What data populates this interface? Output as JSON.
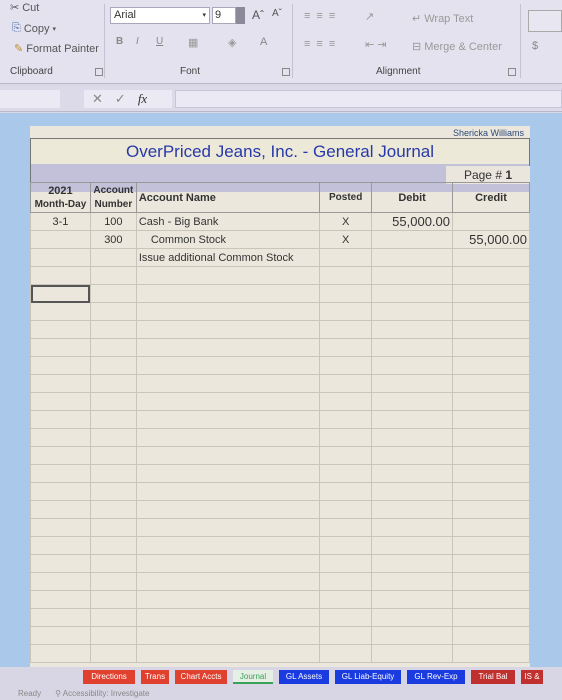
{
  "ribbon": {
    "clipboard": {
      "cut": "Cut",
      "copy": "Copy",
      "format_painter": "Format Painter",
      "label": "Clipboard"
    },
    "font": {
      "font_name": "Arial",
      "font_size": "9",
      "bold": "B",
      "italic": "I",
      "underline": "U",
      "grow": "Aˆ",
      "shrink": "Aˇ",
      "font_color": "A",
      "label": "Font"
    },
    "alignment": {
      "wrap_text": "Wrap Text",
      "merge_center": "Merge & Center",
      "label": "Alignment"
    },
    "number": {
      "currency": "$"
    }
  },
  "formula_bar": {
    "cancel": "✕",
    "enter": "✓",
    "fx": "fx",
    "value": ""
  },
  "journal": {
    "author": "Shericka Williams",
    "title": "OverPriced Jeans, Inc.  -  General Journal",
    "page_label": "Page #",
    "page_number": "1",
    "headers": {
      "year": "2021",
      "month_day": "Month-Day",
      "account": "Account",
      "number": "Number",
      "account_name": "Account Name",
      "posted": "Posted",
      "debit": "Debit",
      "credit": "Credit"
    },
    "rows": [
      {
        "date": "3-1",
        "account": "100",
        "name": "Cash - Big Bank",
        "posted": "X",
        "debit": "55,000.00",
        "credit": ""
      },
      {
        "date": "",
        "account": "300",
        "name": "Common Stock",
        "posted": "X",
        "debit": "",
        "credit": "55,000.00"
      },
      {
        "date": "",
        "account": "",
        "name": "Issue additional Common Stock",
        "posted": "",
        "debit": "",
        "credit": ""
      }
    ]
  },
  "sheet_tabs": [
    {
      "label": "Directions",
      "color": "#e0402e"
    },
    {
      "label": "Trans",
      "color": "#e0402e"
    },
    {
      "label": "Chart Accts",
      "color": "#e0402e"
    },
    {
      "label": "Journal",
      "color": "#3aa15a",
      "active": true
    },
    {
      "label": "GL Assets",
      "color": "#1a3be0"
    },
    {
      "label": "GL Liab-Equity",
      "color": "#1a3be0"
    },
    {
      "label": "GL Rev-Exp",
      "color": "#1a3be0"
    },
    {
      "label": "Trial Bal",
      "color": "#c0302e"
    },
    {
      "label": "IS &",
      "color": "#c0302e"
    }
  ],
  "status_bar": {
    "ready": "Ready",
    "accessibility": "Accessibility: Investigate"
  }
}
